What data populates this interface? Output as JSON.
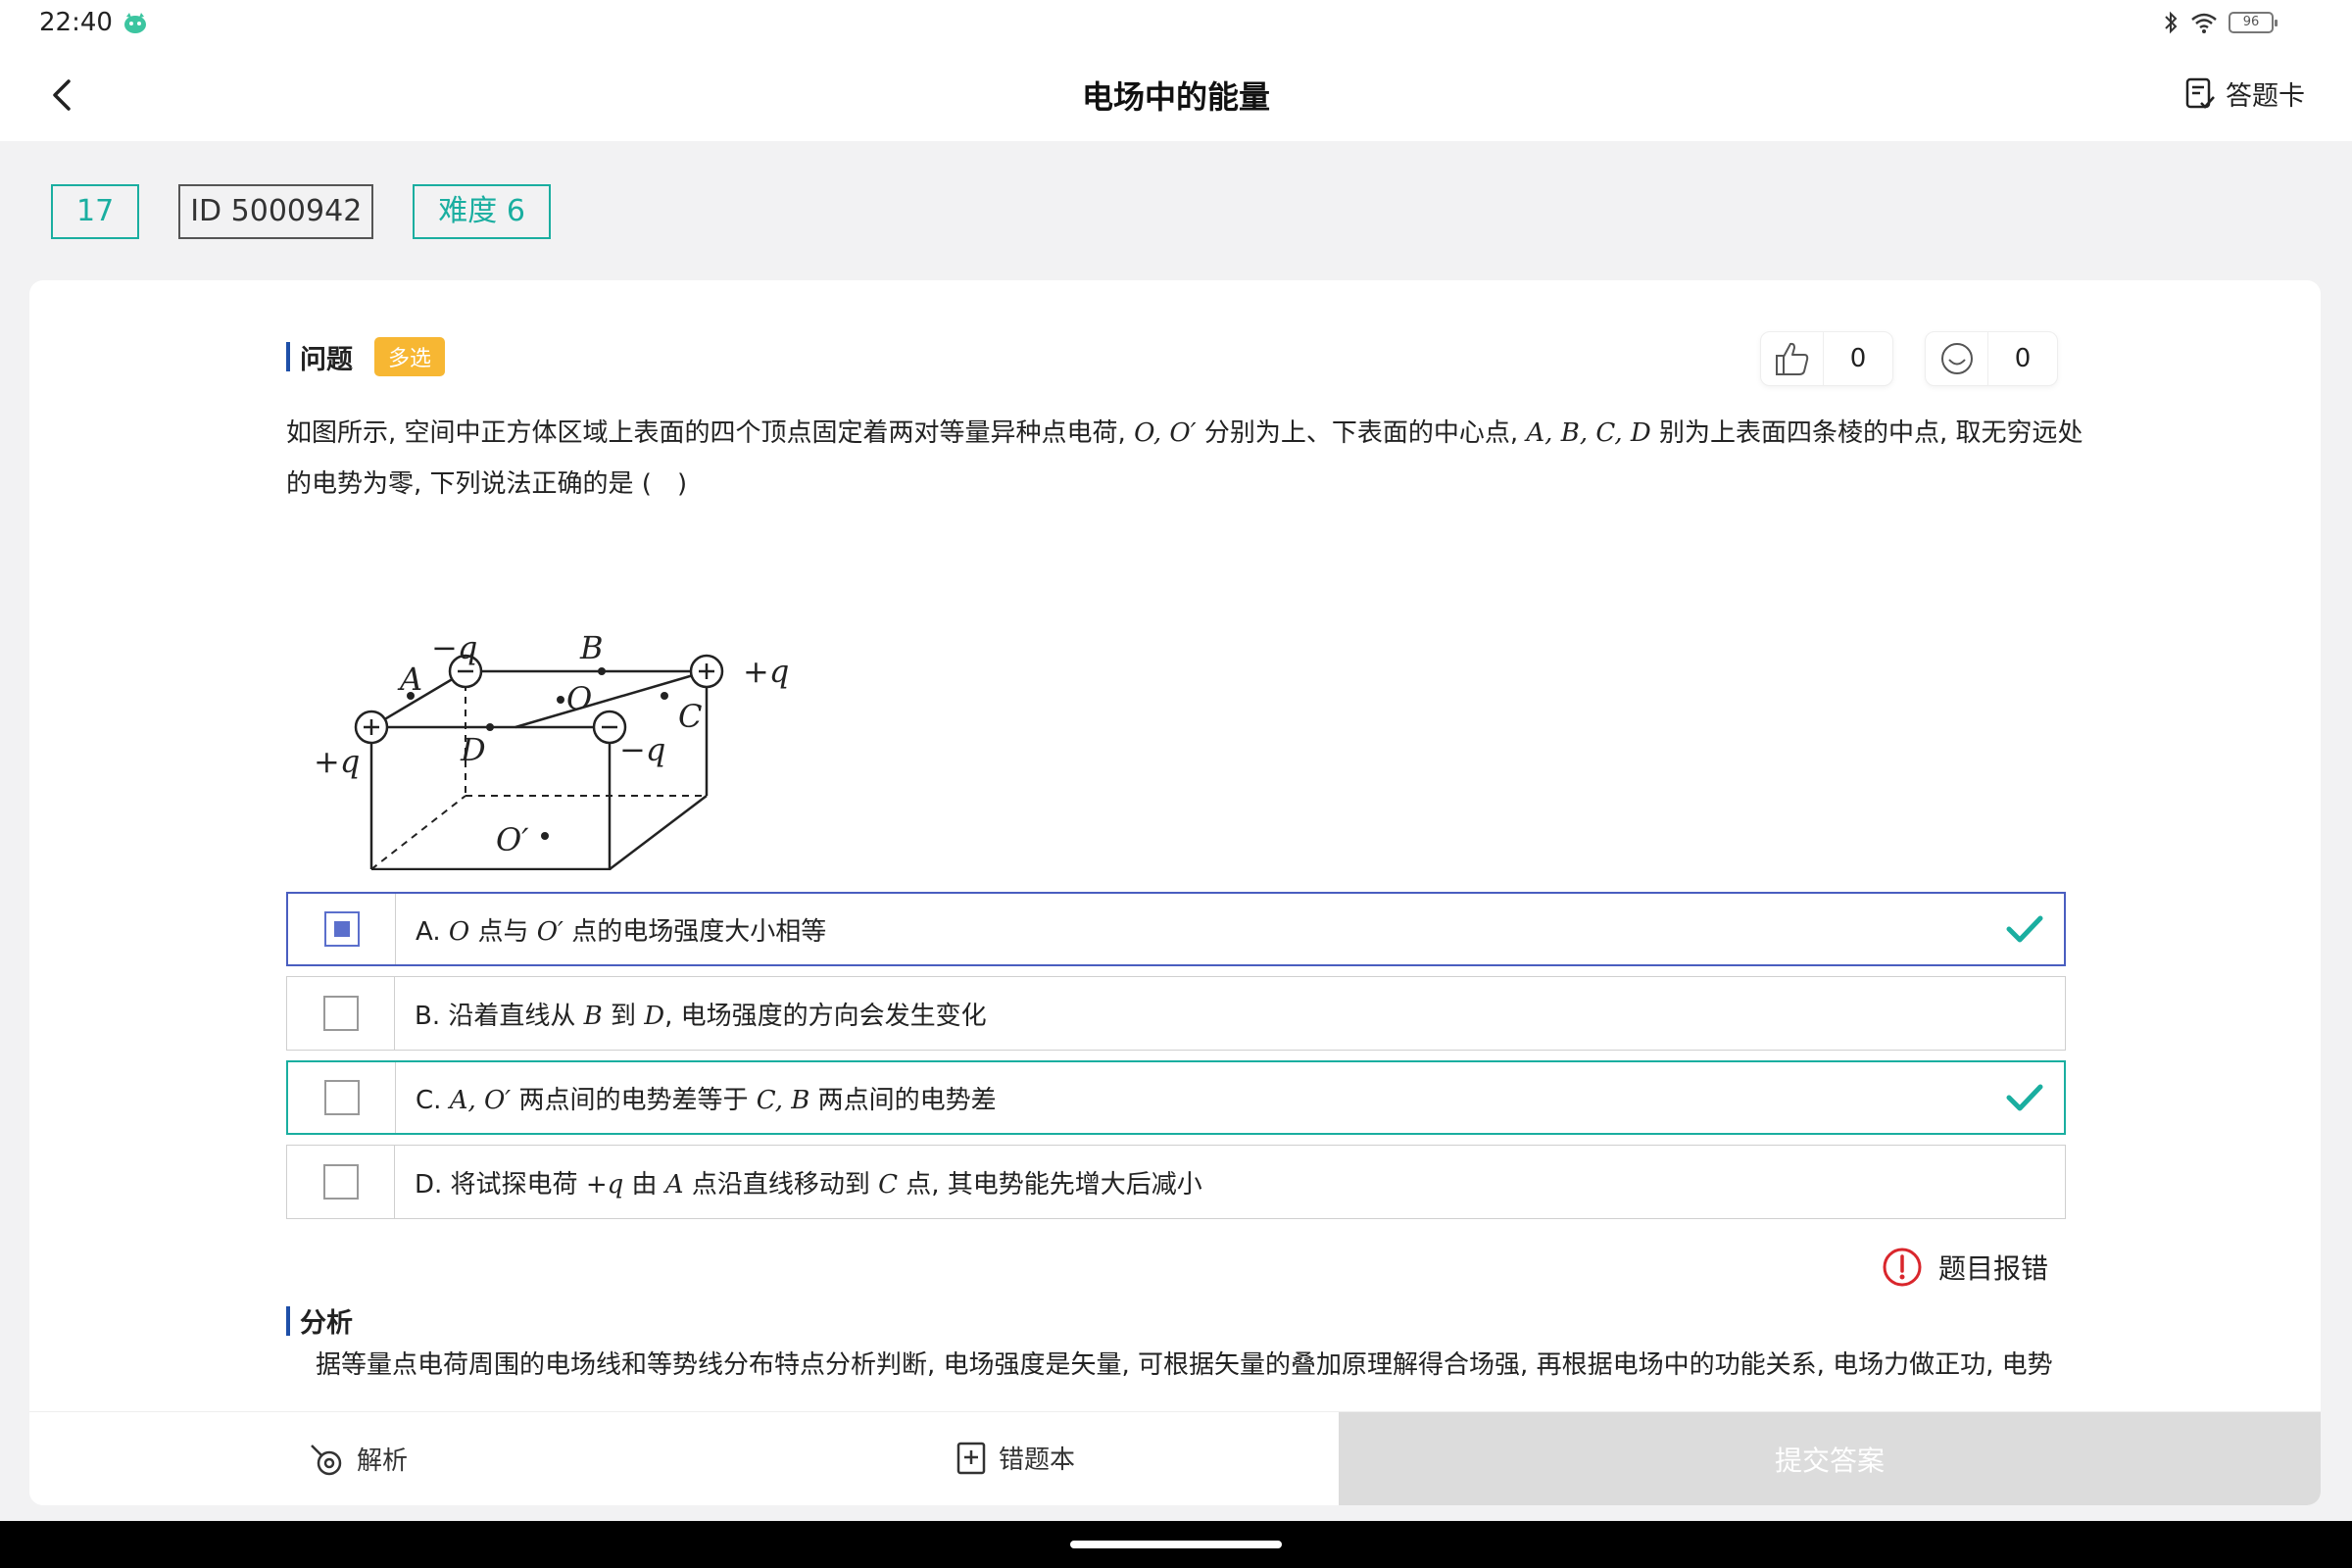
{
  "status": {
    "time": "22:40",
    "battery": "96"
  },
  "nav": {
    "title": "电场中的能量",
    "answer_card": "答题卡"
  },
  "tags": {
    "number": "17",
    "id": "ID 5000942",
    "difficulty": "难度 6"
  },
  "question": {
    "section_label": "问题",
    "type_badge": "多选",
    "likes": "0",
    "smiles": "0",
    "text_parts": {
      "p1": "如图所示, 空间中正方体区域上表面的四个顶点固定着两对等量异种点电荷, ",
      "m1": "O, O′",
      "p2": " 分别为上、下表面的中心点, ",
      "m2": "A, B, C, D",
      "p3": " 别为上表面四条棱的中点, 取无穷远处的电势为零, 下列说法正确的是 (　)"
    }
  },
  "figure": {
    "labels": {
      "neg_q": "−q",
      "pos_q": "+q",
      "A": "A",
      "B": "B",
      "C": "C",
      "D": "D",
      "O": "O",
      "O_prime": "O′"
    }
  },
  "options": [
    {
      "letter": "A.",
      "m1": "O",
      "t1": " 点与 ",
      "m2": "O′",
      "t2": " 点的电场强度大小相等",
      "selected": true,
      "correct": true
    },
    {
      "letter": "B.",
      "t0": " 沿着直线从 ",
      "m1": "B",
      "t1": " 到 ",
      "m2": "D",
      "t2": ", 电场强度的方向会发生变化",
      "selected": false,
      "correct": false
    },
    {
      "letter": "C.",
      "m1": "A, O′",
      "t1": " 两点间的电势差等于 ",
      "m2": "C, B",
      "t2": " 两点间的电势差",
      "selected": false,
      "correct": true
    },
    {
      "letter": "D.",
      "t0": " 将试探电荷 ",
      "m1": "+q",
      "t1": " 由 ",
      "m2": "A",
      "t2": " 点沿直线移动到 ",
      "m3": "C",
      "t3": " 点, 其电势能先增大后减小",
      "selected": false,
      "correct": false
    }
  ],
  "report_label": "题目报错",
  "analysis": {
    "section_label": "分析",
    "text": "据等量点电荷周围的电场线和等势线分布特点分析判断, 电场强度是矢量, 可根据矢量的叠加原理解得合场强, 再根据电场中的功能关系, 电场力做正功, 电势"
  },
  "bottom": {
    "explain": "解析",
    "wrongbook": "错题本",
    "submit": "提交答案"
  },
  "colors": {
    "accent": "#1aaea0",
    "selected": "#4a5ec0",
    "badge": "#f7b733",
    "error": "#d9262c"
  }
}
